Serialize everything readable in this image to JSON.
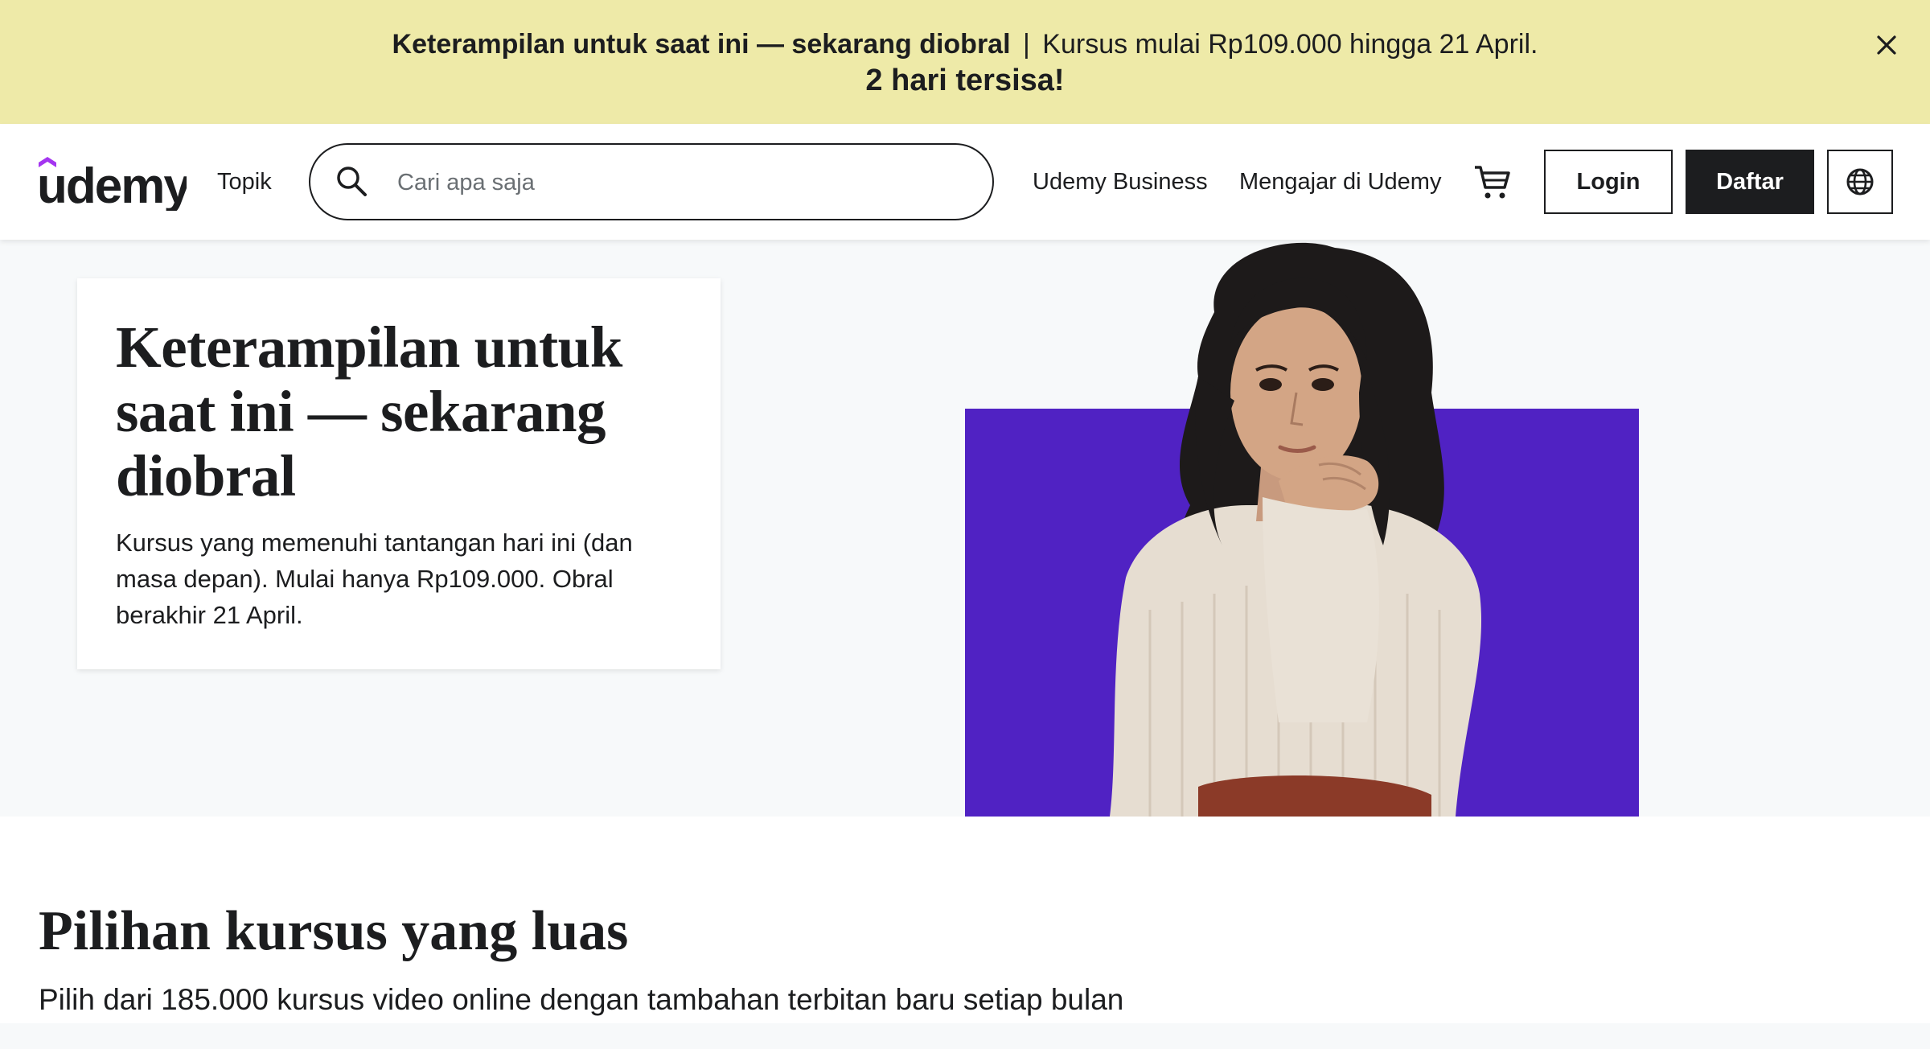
{
  "banner": {
    "headline_bold": "Keterampilan untuk saat ini — sekarang diobral",
    "separator": "|",
    "detail": "Kursus mulai Rp109.000 hingga 21 April.",
    "countdown": "2 hari tersisa!",
    "close_icon": "close-icon",
    "background_color": "#eeeaa8"
  },
  "header": {
    "logo_text": "udemy",
    "topics_label": "Topik",
    "search": {
      "placeholder": "Cari apa saja",
      "value": "",
      "icon": "search-icon"
    },
    "business_label": "Udemy Business",
    "teach_label": "Mengajar di Udemy",
    "cart_icon": "cart-icon",
    "login_label": "Login",
    "signup_label": "Daftar",
    "language_icon": "globe-icon"
  },
  "hero": {
    "title": "Keterampilan untuk saat ini — sekarang diobral",
    "description": "Kursus yang memenuhi tantangan hari ini (dan masa depan). Mulai hanya Rp109.000. Obral berakhir 21 April.",
    "accent_color": "#5022c3"
  },
  "section": {
    "title": "Pilihan kursus yang luas",
    "subtitle": "Pilih dari 185.000 kursus video online dengan tambahan terbitan baru setiap bulan"
  },
  "colors": {
    "brand_purple": "#a435f0",
    "text": "#1c1d1f",
    "hero_bg": "#f7f9fa"
  }
}
